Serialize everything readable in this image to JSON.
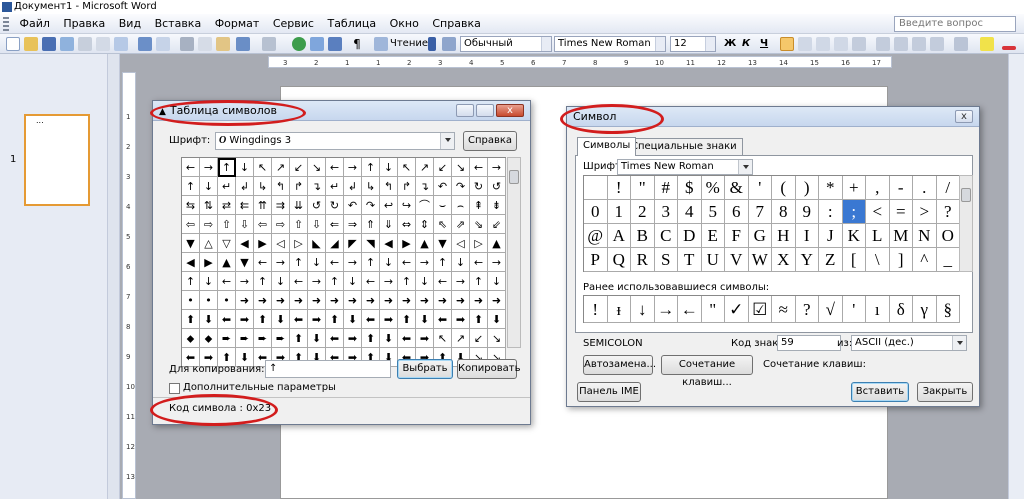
{
  "window": {
    "title": "Документ1 - Microsoft Word"
  },
  "menu": {
    "items": [
      "Файл",
      "Правка",
      "Вид",
      "Вставка",
      "Формат",
      "Сервис",
      "Таблица",
      "Окно",
      "Справка"
    ],
    "help_placeholder": "Введите вопрос"
  },
  "toolbar": {
    "reading_label": "Чтение",
    "style": "Обычный",
    "font": "Times New Roman",
    "size": "12",
    "bold": "Ж",
    "italic": "К",
    "underline": "Ч"
  },
  "ruler": {
    "marks": [
      "3",
      "2",
      "1",
      "1",
      "2",
      "3",
      "4",
      "5",
      "6",
      "7",
      "8",
      "9",
      "10",
      "11",
      "12",
      "13",
      "14",
      "15",
      "16",
      "17"
    ]
  },
  "vruler": {
    "marks": [
      "1",
      "2",
      "3",
      "4",
      "5",
      "6",
      "7",
      "8",
      "9",
      "10",
      "11",
      "12",
      "13"
    ]
  },
  "thumbnail": {
    "page_number": "1",
    "dots": "..."
  },
  "charmap": {
    "title": "Таблица символов",
    "font_label": "Шрифт:",
    "font_glyph": "O",
    "font_value": "Wingdings 3",
    "help_button": "Справка",
    "rows": [
      [
        "←",
        "→",
        "↑",
        "↓",
        "↖",
        "↗",
        "↙",
        "↘",
        "←",
        "→",
        "↑",
        "↓",
        "↖",
        "↗",
        "↙",
        "↘",
        "←",
        "→"
      ],
      [
        "↑",
        "↓",
        "↵",
        "↲",
        "↳",
        "↰",
        "↱",
        "↴",
        "↵",
        "↲",
        "↳",
        "↰",
        "↱",
        "↴",
        "↶",
        "↷",
        "↻",
        "↺"
      ],
      [
        "⇆",
        "⇅",
        "⇄",
        "⇇",
        "⇈",
        "⇉",
        "⇊",
        "↺",
        "↻",
        "↶",
        "↷",
        "↩",
        "↪",
        "⌒",
        "⌣",
        "⌢",
        "⇞",
        "⇟"
      ],
      [
        "⇦",
        "⇨",
        "⇧",
        "⇩",
        "⇦",
        "⇨",
        "⇧",
        "⇩",
        "⇐",
        "⇒",
        "⇑",
        "⇓",
        "⇔",
        "⇕",
        "⇖",
        "⇗",
        "⇘",
        "⇙"
      ],
      [
        "▼",
        "△",
        "▽",
        "◀",
        "▶",
        "◁",
        "▷",
        "◣",
        "◢",
        "◤",
        "◥",
        "◀",
        "▶",
        "▲",
        "▼",
        "◁",
        "▷",
        "▲"
      ],
      [
        "◀",
        "▶",
        "▲",
        "▼",
        "←",
        "→",
        "↑",
        "↓",
        "←",
        "→",
        "↑",
        "↓",
        "←",
        "→",
        "↑",
        "↓",
        "←",
        "→"
      ],
      [
        "↑",
        "↓",
        "←",
        "→",
        "↑",
        "↓",
        "←",
        "→",
        "↑",
        "↓",
        "←",
        "→",
        "↑",
        "↓",
        "←",
        "→",
        "↑",
        "↓"
      ],
      [
        "•",
        "•",
        "•",
        "➜",
        "➜",
        "➜",
        "➜",
        "➜",
        "➜",
        "➜",
        "➜",
        "➜",
        "➜",
        "➜",
        "➜",
        "➜",
        "➜",
        "➜"
      ],
      [
        "⬆",
        "⬇",
        "⬅",
        "➡",
        "⬆",
        "⬇",
        "⬅",
        "➡",
        "⬆",
        "⬇",
        "⬅",
        "➡",
        "⬆",
        "⬇",
        "⬅",
        "➡",
        "⬆",
        "⬇"
      ],
      [
        "⬥",
        "⬥",
        "➨",
        "➨",
        "➨",
        "➨",
        "⬆",
        "⬇",
        "⬅",
        "➡",
        "⬆",
        "⬇",
        "⬅",
        "➡",
        "↖",
        "↗",
        "↙",
        "↘"
      ],
      [
        "⬅",
        "➡",
        "⬆",
        "⬇",
        "⬅",
        "➡",
        "⬆",
        "⬇",
        "⬅",
        "➡",
        "⬆",
        "⬇",
        "⬅",
        "➡",
        "⬆",
        "⬇",
        "↘",
        "↘"
      ]
    ],
    "copy_label": "Для копирования:",
    "copy_value": "↑",
    "select_button": "Выбрать",
    "copy_button": "Копировать",
    "advanced_label": "Дополнительные параметры",
    "status": "Код символа : 0x23"
  },
  "symbol": {
    "title": "Символ",
    "tabs": [
      "Символы",
      "Специальные знаки"
    ],
    "font_label": "Шрифт:",
    "font_value": "Times New Roman",
    "rows": [
      [
        "",
        "!",
        "\"",
        "#",
        "$",
        "%",
        "&",
        "'",
        "(",
        ")",
        "*",
        "+",
        ",",
        "-",
        ".",
        "/"
      ],
      [
        "0",
        "1",
        "2",
        "3",
        "4",
        "5",
        "6",
        "7",
        "8",
        "9",
        ":",
        ";",
        "<",
        "=",
        ">",
        "?"
      ],
      [
        "@",
        "A",
        "B",
        "C",
        "D",
        "E",
        "F",
        "G",
        "H",
        "I",
        "J",
        "K",
        "L",
        "M",
        "N",
        "O"
      ],
      [
        "P",
        "Q",
        "R",
        "S",
        "T",
        "U",
        "V",
        "W",
        "X",
        "Y",
        "Z",
        "[",
        "\\",
        "]",
        "^",
        "_"
      ]
    ],
    "recent_label": "Ранее использовавшиеся символы:",
    "recent": [
      "!",
      "ᵻ",
      "↓",
      "→",
      "←",
      "\"",
      "✓",
      "☑",
      "≈",
      "?",
      "√",
      "'",
      "ı",
      "δ",
      "γ",
      "§"
    ],
    "char_name": "SEMICOLON",
    "code_label": "Код знака:",
    "code_value": "59",
    "from_label": "из:",
    "from_value": "ASCII (дес.)",
    "autocorrect_button": "Автозамена...",
    "shortcut_button": "Сочетание клавиш...",
    "shortcut_label": "Сочетание клавиш:",
    "ime_button": "Панель IME",
    "insert_button": "Вставить",
    "close_button": "Закрыть"
  }
}
